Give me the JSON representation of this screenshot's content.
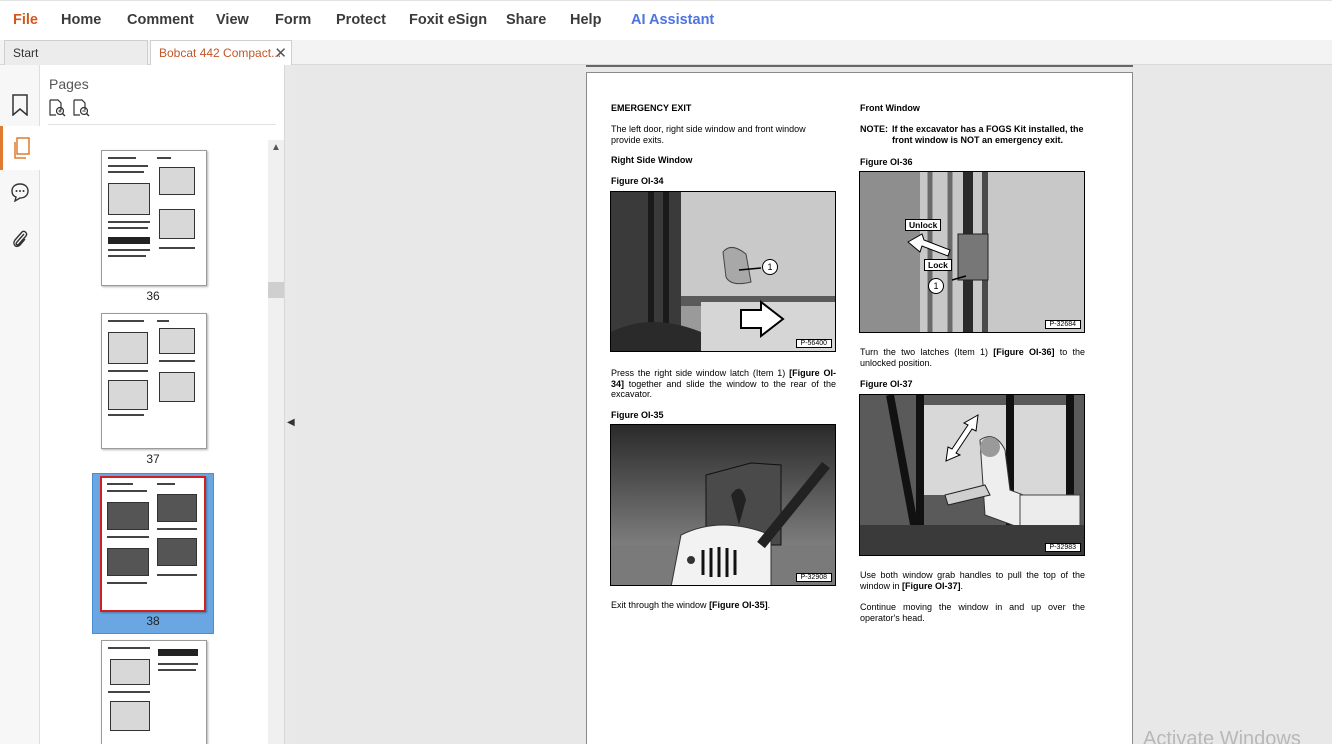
{
  "menu": {
    "file": "File",
    "home": "Home",
    "comment": "Comment",
    "view": "View",
    "form": "Form",
    "protect": "Protect",
    "esign": "Foxit eSign",
    "share": "Share",
    "help": "Help",
    "ai": "AI Assistant"
  },
  "tabs": {
    "start": "Start",
    "doc": "Bobcat 442 Compact...",
    "close_glyph": "✕"
  },
  "panel": {
    "title": "Pages",
    "thumbnails": [
      "36",
      "37",
      "38"
    ],
    "selected": "38"
  },
  "icons": {
    "rail": [
      "bookmark-icon",
      "pages-icon",
      "comment-icon",
      "attachment-icon"
    ],
    "panel_tools": [
      "page-zoom-in-icon",
      "page-zoom-out-icon"
    ]
  },
  "document": {
    "left": {
      "heading": "EMERGENCY EXIT",
      "intro": "The left door, right side window and front window provide exits.",
      "subheading": "Right Side Window",
      "fig1_label": "Figure OI-34",
      "fig1_code": "P-56400",
      "fig1_callout": "1",
      "para1_a": "Press the right side window latch (Item 1) ",
      "para1_ref": "[Figure OI-34]",
      "para1_b": " together and slide the window to the rear of the excavator.",
      "fig2_label": "Figure OI-35",
      "fig2_code": "P-32908",
      "para2_a": "Exit through the window ",
      "para2_ref": "[Figure OI-35]",
      "para2_b": "."
    },
    "right": {
      "heading": "Front Window",
      "note_label": "NOTE:",
      "note_text": "If the excavator has a FOGS Kit installed, the front window is NOT an emergency exit.",
      "fig3_label": "Figure OI-36",
      "fig3_code": "P-32684",
      "fig3_unlock": "Unlock",
      "fig3_lock": "Lock",
      "fig3_callout": "1",
      "para3_a": "Turn the two latches (Item 1) ",
      "para3_ref": "[Figure OI-36]",
      "para3_b": " to the unlocked position.",
      "fig4_label": "Figure OI-37",
      "fig4_code": "P-32983",
      "para4_a": "Use both window grab handles to pull the top of the window in ",
      "para4_ref": "[Figure OI-37]",
      "para4_b": ".",
      "para5": "Continue moving the window in and up over the operator's head."
    }
  },
  "watermark": "Activate Windows",
  "colors": {
    "accent": "#d4581c",
    "ai": "#4d74e0",
    "selection": "#6aa7e2",
    "selected_border": "#d12020"
  }
}
